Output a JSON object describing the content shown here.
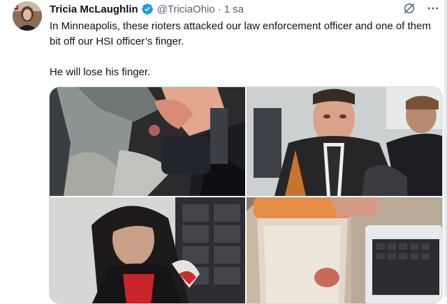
{
  "tweet": {
    "author_name": "Tricia McLaughlin",
    "handle": "@TriciaOhio",
    "separator": "·",
    "time": "1 sa",
    "paragraphs": [
      "In Minneapolis, these rioters attacked our law enforcement officer and one of them bit off our HSI officer’s finger.",
      "He will lose his finger."
    ]
  },
  "icons": {
    "verified": "verified-badge-icon",
    "grok": "grok-icon",
    "more": "more-options-icon"
  },
  "colors": {
    "verified": "#1d9bf0",
    "secondary_text": "#536471"
  }
}
